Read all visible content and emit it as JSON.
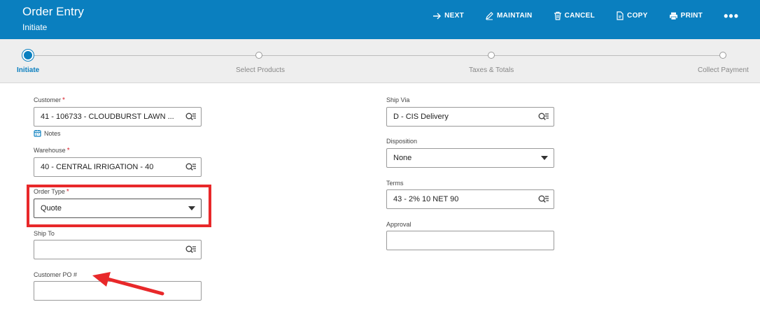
{
  "header": {
    "title": "Order Entry",
    "subtitle": "Initiate",
    "actions": [
      {
        "label": "NEXT",
        "icon": "arrow-right-icon"
      },
      {
        "label": "MAINTAIN",
        "icon": "pencil-icon"
      },
      {
        "label": "CANCEL",
        "icon": "trash-icon"
      },
      {
        "label": "COPY",
        "icon": "copy-icon"
      },
      {
        "label": "PRINT",
        "icon": "printer-icon"
      }
    ],
    "more_label": "•••"
  },
  "stepper": {
    "steps": [
      {
        "label": "Initiate",
        "active": true
      },
      {
        "label": "Select Products",
        "active": false
      },
      {
        "label": "Taxes & Totals",
        "active": false
      },
      {
        "label": "Collect Payment",
        "active": false
      }
    ]
  },
  "form": {
    "required_mark": "*",
    "customer": {
      "label": "Customer",
      "value": "41 - 106733 - CLOUDBURST LAWN ..."
    },
    "notes_label": "Notes",
    "warehouse": {
      "label": "Warehouse",
      "value": "40 - CENTRAL IRRIGATION - 40"
    },
    "order_type": {
      "label": "Order Type",
      "value": "Quote"
    },
    "ship_to": {
      "label": "Ship To",
      "value": ""
    },
    "customer_po": {
      "label": "Customer PO #",
      "value": ""
    },
    "ship_via": {
      "label": "Ship Via",
      "value": "D - CIS Delivery"
    },
    "disposition": {
      "label": "Disposition",
      "value": "None"
    },
    "terms": {
      "label": "Terms",
      "value": "43 - 2% 10 NET 90"
    },
    "approval": {
      "label": "Approval",
      "value": ""
    }
  },
  "colors": {
    "header_bg": "#0a7fbf",
    "highlight": "#e8282a",
    "required": "#d9232e"
  }
}
